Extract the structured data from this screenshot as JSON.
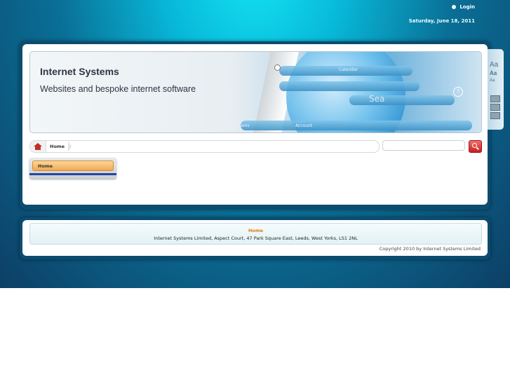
{
  "header": {
    "login_label": "Login",
    "date": "Saturday, June 18, 2011"
  },
  "banner": {
    "title": "Internet Systems",
    "subtitle": "Websites and bespoke internet software",
    "overlay_labels": [
      "Calendar",
      "ams",
      "Account",
      "Sea"
    ]
  },
  "breadcrumb": {
    "items": [
      "Home"
    ]
  },
  "search": {
    "placeholder": ""
  },
  "nav": {
    "items": [
      "Home"
    ]
  },
  "side_tools": {
    "labels": [
      "Aa",
      "Aa",
      "Aa"
    ]
  },
  "footer": {
    "home_link": "Home",
    "address": "Internet Systems Limited, Aspect Court, 47 Park Square East, Leeds, West Yorks, LS1 2NL",
    "copyright": "Copyright 2010 by Internet Systems Limited"
  },
  "colors": {
    "accent": "#0ac9e4",
    "nav_active": "#f1a94c",
    "footer_link": "#e07a10",
    "search_button": "#c42020"
  }
}
